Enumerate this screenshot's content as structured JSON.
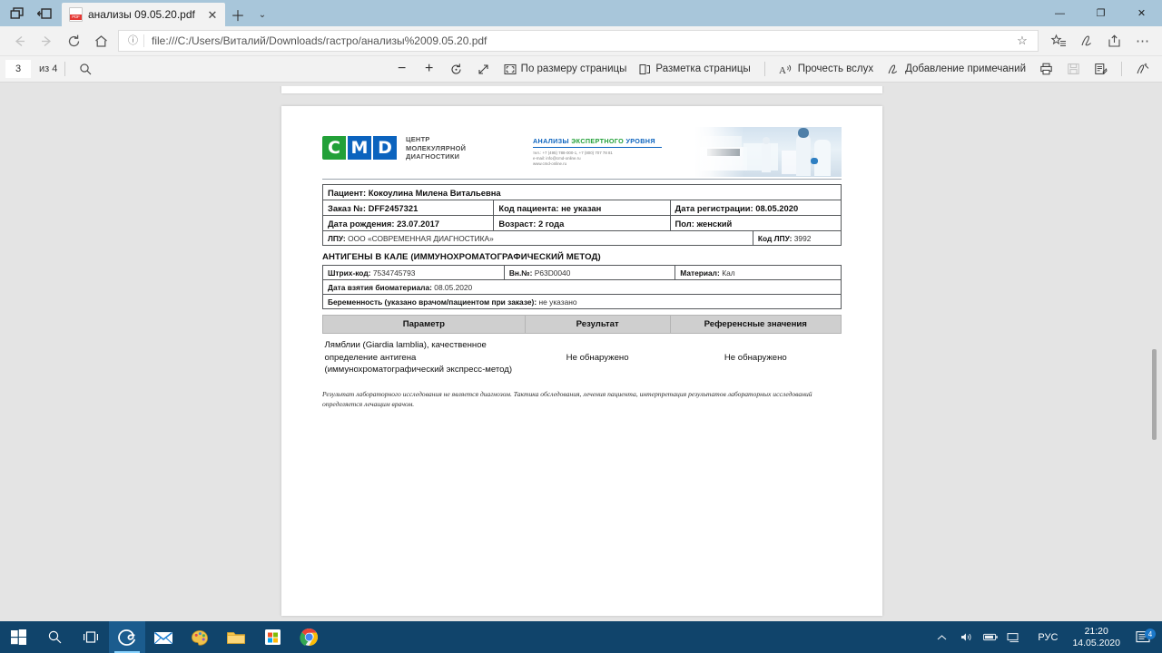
{
  "browser": {
    "tab": {
      "title": "анализы 09.05.20.pdf",
      "favicon": "pdf-icon"
    },
    "url": "file:///C:/Users/Виталий/Downloads/гастро/анализы%2009.05.20.pdf",
    "window_controls": {
      "minimize": "—",
      "restore": "❐",
      "close": "✕"
    },
    "nav": {
      "back": "←",
      "forward": "→",
      "refresh": "↻",
      "home": "⌂"
    }
  },
  "pdf_toolbar": {
    "page_current": "3",
    "page_total": "из 4",
    "search": "search-icon",
    "zoom_out": "−",
    "zoom_in": "+",
    "rotate": "rotate-icon",
    "fit_expand": "expand-icon",
    "fit_page_label": "По размеру страницы",
    "page_layout_label": "Разметка страницы",
    "read_aloud_label": "Прочесть вслух",
    "add_notes_label": "Добавление примечаний",
    "print": "print-icon",
    "save": "save-icon",
    "save_as": "save-as-icon",
    "highlight": "highlight-icon"
  },
  "report": {
    "logo": {
      "c": "C",
      "m": "M",
      "d": "D",
      "word1": "ЦЕНТР",
      "word2": "МОЛЕКУЛЯРНОЙ",
      "word3": "ДИАГНОСТИКИ"
    },
    "expert": {
      "title_blue": "АНАЛИЗЫ",
      "title_green": "ЭКСПЕРТНОГО",
      "title_blue2": "УРОВНЯ",
      "phone": "тел.: +7 (495) 788-000-1, +7 (800) 707 78 81",
      "email": "e-mail: info@cmd-online.ru",
      "site": "www.cmd-online.ru"
    },
    "patient": {
      "patient_label": "Пациент:",
      "patient_value": "Кокоулина Милена Витальевна",
      "order_label": "Заказ №:",
      "order_value": "DFF2457321",
      "patient_code_label": "Код пациента:",
      "patient_code_value": "не указан",
      "reg_date_label": "Дата регистрации:",
      "reg_date_value": "08.05.2020",
      "birth_label": "Дата рождения:",
      "birth_value": "23.07.2017",
      "age_label": "Возраст:",
      "age_value": "2 года",
      "sex_label": "Пол:",
      "sex_value": "женский",
      "lpu_label": "ЛПУ:",
      "lpu_value": "ООО «СОВРЕМЕННАЯ ДИАГНОСТИКА»",
      "lpu_code_label": "Код ЛПУ:",
      "lpu_code_value": "3992"
    },
    "section_title": "АНТИГЕНЫ В КАЛЕ (ИММУНОХРОМАТОГРАФИЧЕСКИЙ МЕТОД)",
    "sample": {
      "barcode_label": "Штрих-код:",
      "barcode_value": "7534745793",
      "inner_no_label": "Вн.№:",
      "inner_no_value": "P63D0040",
      "material_label": "Материал:",
      "material_value": "Кал",
      "collect_date_label": "Дата взятия биоматериала:",
      "collect_date_value": "08.05.2020",
      "pregnancy_label": "Беременность (указано врачом/пациентом при заказе):",
      "pregnancy_value": "не указано"
    },
    "results_table": {
      "headers": [
        "Параметр",
        "Результат",
        "Референсные значения"
      ],
      "rows": [
        {
          "parameter": "Лямблии (Giardia lamblia), качественное определение антигена (иммунохроматографический экспресс-метод)",
          "result": "Не обнаружено",
          "reference": "Не обнаружено"
        }
      ]
    },
    "disclaimer": "Результат лабораторного исследования не является диагнозом. Тактика обследования, лечения пациента, интерпретация результатов лабораторных исследований определяется лечащим врачом."
  },
  "taskbar": {
    "start": "windows-start-icon",
    "search": "search-icon",
    "task_view": "task-view-icon",
    "apps": [
      "edge-icon",
      "mail-icon",
      "paint-icon",
      "file-explorer-icon",
      "microsoft-store-icon",
      "chrome-icon"
    ],
    "tray": {
      "show_hidden": "chevron-up-icon",
      "volume": "volume-icon",
      "battery": "battery-icon",
      "network": "network-icon",
      "language": "РУС",
      "time": "21:20",
      "date": "14.05.2020",
      "notifications_count": "4"
    }
  },
  "colors": {
    "logo_green": "#22a038",
    "logo_blue": "#0b63be",
    "taskbar": "#10446b",
    "titlebar": "#a8c6da"
  }
}
